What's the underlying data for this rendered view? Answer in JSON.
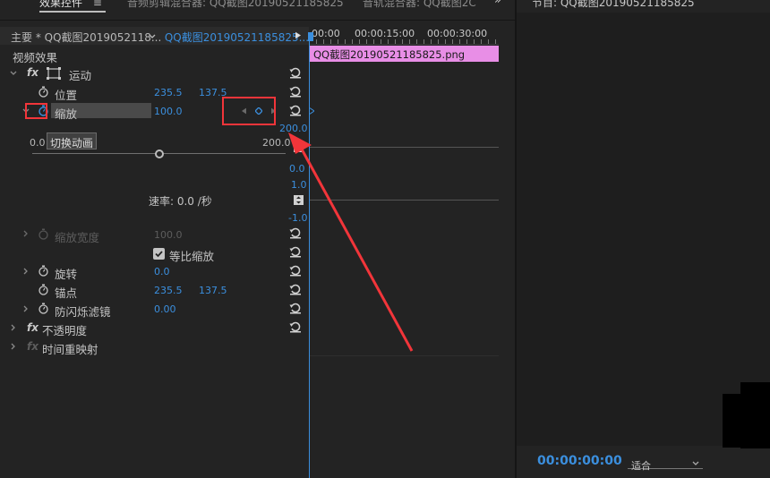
{
  "tabs": {
    "effects_controls": "效果控件",
    "menu_glyph": "≡",
    "audio_mixer": "音频剪辑混合器: QQ截图20190521185825",
    "track_mixer": "音轨混合器: QQ截图2C",
    "program": "节目: QQ截图20190521185825"
  },
  "source": {
    "master": "主要 * QQ截图2019052118...",
    "clip": "QQ截图20190521185825..."
  },
  "timeline": {
    "ticks": [
      "00:00",
      "00:00:15:00",
      "00:00:30:00"
    ],
    "clip_label": "QQ截图20190521185825.png"
  },
  "effects": {
    "section_title": "视频效果",
    "fx": "fx",
    "motion": "运动",
    "position": {
      "label": "位置",
      "x": "235.5",
      "y": "137.5"
    },
    "scale": {
      "label": "缩放",
      "value": "100.0"
    },
    "scale_graph": {
      "min": "0.0",
      "max": "200.0",
      "axis_top": "200.0",
      "axis_mid": "0.0",
      "tooltip": "切换动画",
      "speed_label": "速率: 0.0 /秒",
      "speed_top": "1.0",
      "speed_bottom": "-1.0"
    },
    "scale_width": {
      "label": "缩放宽度",
      "value": "100.0"
    },
    "uniform": {
      "label": "等比缩放",
      "checked": true
    },
    "rotation": {
      "label": "旋转",
      "value": "0.0"
    },
    "anchor": {
      "label": "锚点",
      "x": "235.5",
      "y": "137.5"
    },
    "antiflicker": {
      "label": "防闪烁滤镜",
      "value": "0.00"
    },
    "opacity": {
      "label": "不透明度"
    },
    "time_remap": {
      "label": "时间重映射"
    }
  },
  "program": {
    "timecode": "00:00:00:00",
    "fit": "适合"
  },
  "colors": {
    "accent_blue": "#3b8fde",
    "clip_pink": "#e88ee6",
    "annotation_red": "#f2353a"
  }
}
